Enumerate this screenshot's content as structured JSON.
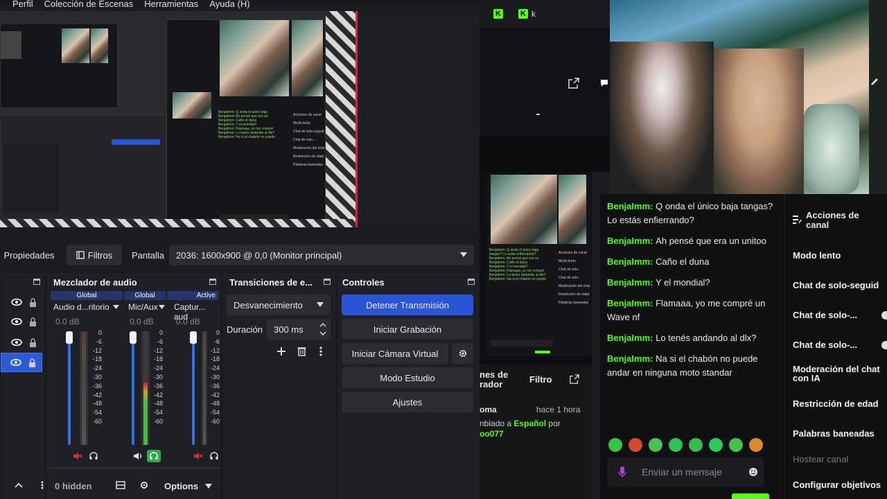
{
  "obs": {
    "menu": [
      "Perfil",
      "Colección de Escenas",
      "Herramientas",
      "Ayuda (H)"
    ],
    "propbar": {
      "properties_label": "Propiedades",
      "filters_label": "Filtros",
      "display_label": "Pantalla",
      "display_value": "2036: 1600x900 @ 0,0 (Monitor principal)"
    },
    "mixer": {
      "title": "Mezclador de audio",
      "channels": [
        {
          "name": "Audio d...ritorio",
          "head": "Global",
          "db": "0.0 dB",
          "level": 0.0
        },
        {
          "name": "Mic/Aux",
          "head": "Global",
          "db": "0.0 dB",
          "level": 0.55
        },
        {
          "name": "Captur... aud",
          "head": "Active",
          "db": "0.0 dB",
          "level": 0.0
        }
      ],
      "scale": [
        "0",
        "-6",
        "-12",
        "-18",
        "-24",
        "-30",
        "-36",
        "-42",
        "-48",
        "-54",
        "-60"
      ],
      "hidden_label": "0 hidden",
      "options_label": "Options"
    },
    "transitions": {
      "title": "Transiciones de e...",
      "selected": "Desvanecimiento",
      "duration_label": "Duración",
      "duration_value": "300 ms"
    },
    "controls": {
      "title": "Controles",
      "stop_stream": "Detener Transmisión",
      "start_record": "Iniciar Grabación",
      "virtual_cam": "Iniciar Cámara Virtual",
      "studio_mode": "Modo Estudio",
      "settings": "Ajustes"
    }
  },
  "kick": {
    "top_letter": "k",
    "mod_panel": {
      "title_fragment_1": "nes de",
      "title_fragment_2": "rador",
      "filter_label": "Filtro",
      "event_title": "oma",
      "event_time": "hace 1 hora",
      "event_text_1": "nbiado a",
      "event_lang": "Español",
      "event_text_2": "por",
      "event_user": "oo077"
    },
    "chat": {
      "messages": [
        {
          "user": "BenjaImm",
          "text": "Q onda el único baja tangas? Lo estás enfierrando?"
        },
        {
          "user": "BenjaImm",
          "text": "Ah pensé que era un unitoo"
        },
        {
          "user": "BenjaImm",
          "text": "Caño el duna"
        },
        {
          "user": "BenjaImm",
          "text": "Y el mondial?"
        },
        {
          "user": "BenjaImm",
          "text": "Flamaaa, yo me compré un Wave nf"
        },
        {
          "user": "BenjaImm",
          "text": "Lo tenés andando al dlx?"
        },
        {
          "user": "BenjaImm",
          "text": "Na si el chabón no puede andar en ninguna moto standar"
        }
      ],
      "input_placeholder": "Enviar un mensaje"
    },
    "actions": {
      "title": "Acciones de canal",
      "items": [
        "Modo lento",
        "Chat de solo-seguid",
        "Chat de solo-...",
        "Chat de solo-...",
        "Moderación del chat con IA",
        "Restricción de edad",
        "Palabras baneadas",
        "Hostear canal",
        "Configurar objetivos"
      ]
    }
  },
  "colors": {
    "kick_green": "#53fc18",
    "obs_blue": "#2a55d6",
    "stream_red": "#e0242b"
  }
}
